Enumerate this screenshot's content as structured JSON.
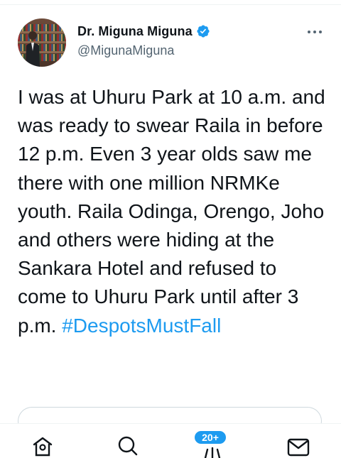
{
  "tweet": {
    "author": {
      "display_name": "Dr. Miguna Miguna",
      "handle": "@MigunaMiguna",
      "verified": true
    },
    "text": "I was at Uhuru Park at 10 a.m. and was ready to swear Raila in before 12 p.m. Even 3 year olds saw me there with one million NRMKe youth. Raila Odinga, Orengo, Joho and others were hiding at the Sankara Hotel and refused to come to Uhuru Park until after 3 p.m. ",
    "hashtag": "#DespotsMustFall"
  },
  "tabbar": {
    "items": [
      {
        "icon": "home-icon"
      },
      {
        "icon": "search-icon"
      },
      {
        "icon": "spaces-icon"
      },
      {
        "icon": "messages-icon"
      }
    ],
    "notification_badge": "20+"
  },
  "colors": {
    "accent": "#1d9bf0",
    "text": "#0f1419",
    "secondary_text": "#536471"
  }
}
